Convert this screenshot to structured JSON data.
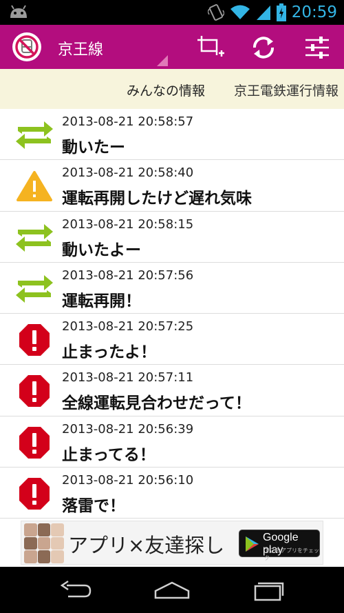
{
  "status_bar": {
    "time": "20:59",
    "icons": [
      "android-icon",
      "vibrate-icon",
      "wifi-icon",
      "signal-icon",
      "battery-charging-icon"
    ]
  },
  "action_bar": {
    "app_icon": "no-train-logo-icon",
    "line_name": "京王線",
    "actions": [
      "add-post-icon",
      "refresh-icon",
      "settings-sliders-icon"
    ]
  },
  "tabs": {
    "active": "みんなの情報",
    "next": "京王電鉄運行情報"
  },
  "posts": [
    {
      "status": "moving",
      "icon": "moving-arrows-icon",
      "time": "2013-08-21 20:58:57",
      "message": "動いたー"
    },
    {
      "status": "warning",
      "icon": "warning-icon",
      "time": "2013-08-21 20:58:40",
      "message": "運転再開したけど遅れ気味"
    },
    {
      "status": "moving",
      "icon": "moving-arrows-icon",
      "time": "2013-08-21 20:58:15",
      "message": "動いたよー"
    },
    {
      "status": "moving",
      "icon": "moving-arrows-icon",
      "time": "2013-08-21 20:57:56",
      "message": "運転再開！"
    },
    {
      "status": "stopped",
      "icon": "stop-icon",
      "time": "2013-08-21 20:57:25",
      "message": "止まったよ！"
    },
    {
      "status": "stopped",
      "icon": "stop-icon",
      "time": "2013-08-21 20:57:11",
      "message": "全線運転見合わせだって！"
    },
    {
      "status": "stopped",
      "icon": "stop-icon",
      "time": "2013-08-21 20:56:39",
      "message": "止まってる！"
    },
    {
      "status": "stopped",
      "icon": "stop-icon",
      "time": "2013-08-21 20:56:10",
      "message": "落雷で！"
    }
  ],
  "ad": {
    "text": "アプリ×友達探し",
    "badge_main": "Google play",
    "badge_sub": "でこのアプリをチェック"
  },
  "colors": {
    "action_bar": "#b30d7e",
    "tab_bar": "#f7f4dc",
    "moving": "#8dc21f",
    "warning": "#f5b321",
    "stopped": "#d3001a",
    "status_time": "#33b5e5"
  },
  "nav_bar": {
    "buttons": [
      "back-icon",
      "home-icon",
      "recents-icon"
    ]
  }
}
